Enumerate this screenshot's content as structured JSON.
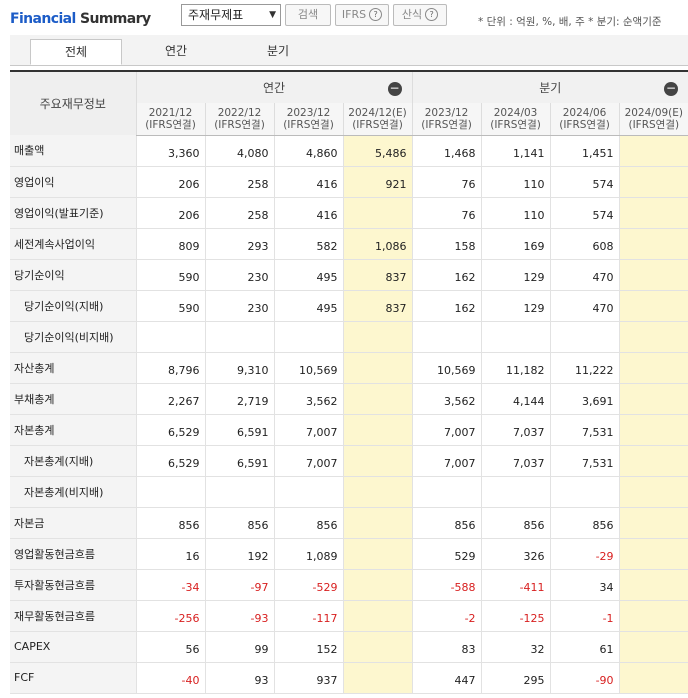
{
  "header": {
    "brand_part1": "Financial",
    "brand_part2": "Summary",
    "select_value": "주재무제표",
    "search_label": "검색",
    "ifrs_label": "IFRS",
    "formula_label": "산식",
    "help_glyph": "?",
    "unit_note": "* 단위 : 억원, %, 배, 주    * 분기: 순액기준"
  },
  "tabs": [
    {
      "label": "전체",
      "active": true
    },
    {
      "label": "연간",
      "active": false
    },
    {
      "label": "분기",
      "active": false
    }
  ],
  "table": {
    "corner_label": "주요재무정보",
    "group_annual": "연간",
    "group_quarter": "분기",
    "collapse_glyph": "−",
    "columns": [
      {
        "period": "2021/12",
        "basis": "(IFRS연결)"
      },
      {
        "period": "2022/12",
        "basis": "(IFRS연결)"
      },
      {
        "period": "2023/12",
        "basis": "(IFRS연결)"
      },
      {
        "period": "2024/12(E)",
        "basis": "(IFRS연결)"
      },
      {
        "period": "2023/12",
        "basis": "(IFRS연결)"
      },
      {
        "period": "2024/03",
        "basis": "(IFRS연결)"
      },
      {
        "period": "2024/06",
        "basis": "(IFRS연결)"
      },
      {
        "period": "2024/09(E)",
        "basis": "(IFRS연결)"
      }
    ],
    "rows": [
      {
        "label": "매출액",
        "sub": false,
        "values": [
          "3,360",
          "4,080",
          "4,860",
          "5,486",
          "1,468",
          "1,141",
          "1,451",
          ""
        ]
      },
      {
        "label": "영업이익",
        "sub": false,
        "values": [
          "206",
          "258",
          "416",
          "921",
          "76",
          "110",
          "574",
          ""
        ]
      },
      {
        "label": "영업이익(발표기준)",
        "sub": false,
        "values": [
          "206",
          "258",
          "416",
          "",
          "76",
          "110",
          "574",
          ""
        ]
      },
      {
        "label": "세전계속사업이익",
        "sub": false,
        "values": [
          "809",
          "293",
          "582",
          "1,086",
          "158",
          "169",
          "608",
          ""
        ]
      },
      {
        "label": "당기순이익",
        "sub": false,
        "values": [
          "590",
          "230",
          "495",
          "837",
          "162",
          "129",
          "470",
          ""
        ]
      },
      {
        "label": "당기순이익(지배)",
        "sub": true,
        "values": [
          "590",
          "230",
          "495",
          "837",
          "162",
          "129",
          "470",
          ""
        ]
      },
      {
        "label": "당기순이익(비지배)",
        "sub": true,
        "values": [
          "",
          "",
          "",
          "",
          "",
          "",
          "",
          ""
        ]
      },
      {
        "label": "자산총계",
        "sub": false,
        "values": [
          "8,796",
          "9,310",
          "10,569",
          "",
          "10,569",
          "11,182",
          "11,222",
          ""
        ]
      },
      {
        "label": "부채총계",
        "sub": false,
        "values": [
          "2,267",
          "2,719",
          "3,562",
          "",
          "3,562",
          "4,144",
          "3,691",
          ""
        ]
      },
      {
        "label": "자본총계",
        "sub": false,
        "values": [
          "6,529",
          "6,591",
          "7,007",
          "",
          "7,007",
          "7,037",
          "7,531",
          ""
        ]
      },
      {
        "label": "자본총계(지배)",
        "sub": true,
        "values": [
          "6,529",
          "6,591",
          "7,007",
          "",
          "7,007",
          "7,037",
          "7,531",
          ""
        ]
      },
      {
        "label": "자본총계(비지배)",
        "sub": true,
        "values": [
          "",
          "",
          "",
          "",
          "",
          "",
          "",
          ""
        ]
      },
      {
        "label": "자본금",
        "sub": false,
        "values": [
          "856",
          "856",
          "856",
          "",
          "856",
          "856",
          "856",
          ""
        ]
      },
      {
        "label": "영업활동현금흐름",
        "sub": false,
        "values": [
          "16",
          "192",
          "1,089",
          "",
          "529",
          "326",
          "-29",
          ""
        ]
      },
      {
        "label": "투자활동현금흐름",
        "sub": false,
        "values": [
          "-34",
          "-97",
          "-529",
          "",
          "-588",
          "-411",
          "34",
          ""
        ]
      },
      {
        "label": "재무활동현금흐름",
        "sub": false,
        "values": [
          "-256",
          "-93",
          "-117",
          "",
          "-2",
          "-125",
          "-1",
          ""
        ]
      },
      {
        "label": "CAPEX",
        "sub": false,
        "values": [
          "56",
          "99",
          "152",
          "",
          "83",
          "32",
          "61",
          ""
        ]
      },
      {
        "label": "FCF",
        "sub": false,
        "values": [
          "-40",
          "93",
          "937",
          "",
          "447",
          "295",
          "-90",
          ""
        ]
      }
    ]
  },
  "colors": {
    "brand_blue": "#1c5cc7",
    "estimate_bg": "#fdf7cf",
    "negative": "#d81f1f"
  }
}
